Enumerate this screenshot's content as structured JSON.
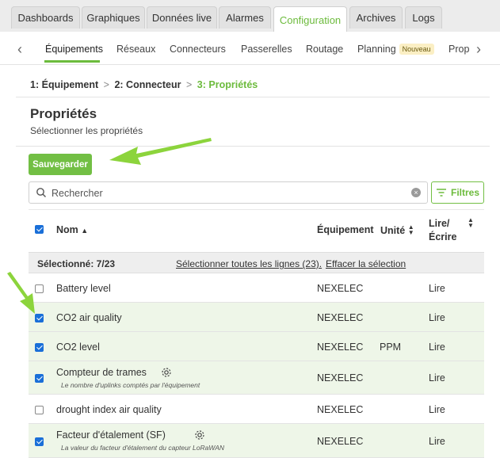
{
  "top_tabs": [
    "Dashboards",
    "Graphiques",
    "Données live",
    "Alarmes",
    "Configuration",
    "Archives",
    "Logs"
  ],
  "sub_nav": {
    "items": [
      "Équipements",
      "Réseaux",
      "Connecteurs",
      "Passerelles",
      "Routage",
      "Planning",
      "Prop"
    ],
    "badge": "Nouveau"
  },
  "breadcrumb": {
    "step1_num": "1:",
    "step1": "Équipement",
    "step2_num": "2:",
    "step2": "Connecteur",
    "step3_num": "3:",
    "step3": "Propriétés",
    "separator": ">"
  },
  "page": {
    "title": "Propriétés",
    "subtitle": "Sélectionner les propriétés",
    "save_label": "Sauvegarder",
    "search_placeholder": "Rechercher",
    "filters_label": "Filtres"
  },
  "table": {
    "headers": {
      "name": "Nom",
      "equipment": "Équipement",
      "unit": "Unité",
      "rw_line1": "Lire/",
      "rw_line2": "Écrire"
    },
    "selection": {
      "count": "Sélectionné: 7/23",
      "select_all": "Sélectionner toutes les lignes (23).",
      "clear": "Effacer la sélection"
    },
    "rows": [
      {
        "name": "Battery level",
        "desc": "",
        "equipment": "NEXELEC",
        "unit": "",
        "rw": "Lire",
        "checked": false,
        "gear": false
      },
      {
        "name": "CO2 air quality",
        "desc": "",
        "equipment": "NEXELEC",
        "unit": "",
        "rw": "Lire",
        "checked": true,
        "gear": false
      },
      {
        "name": "CO2 level",
        "desc": "",
        "equipment": "NEXELEC",
        "unit": "PPM",
        "rw": "Lire",
        "checked": true,
        "gear": false
      },
      {
        "name": "Compteur de trames",
        "desc": "Le nombre d'uplinks comptés par l'équipement",
        "equipment": "NEXELEC",
        "unit": "",
        "rw": "Lire",
        "checked": true,
        "gear": true
      },
      {
        "name": "drought index air quality",
        "desc": "",
        "equipment": "NEXELEC",
        "unit": "",
        "rw": "Lire",
        "checked": false,
        "gear": false
      },
      {
        "name": "Facteur d'étalement (SF)",
        "desc": "La valeur du facteur d'étalement du capteur LoRaWAN",
        "equipment": "NEXELEC",
        "unit": "",
        "rw": "Lire",
        "checked": true,
        "gear": true
      }
    ]
  },
  "colors": {
    "accent": "#6cbb3c",
    "checkbox": "#1a6fd8",
    "checked_row": "#eef6e8",
    "arrow": "#8cd43c"
  }
}
